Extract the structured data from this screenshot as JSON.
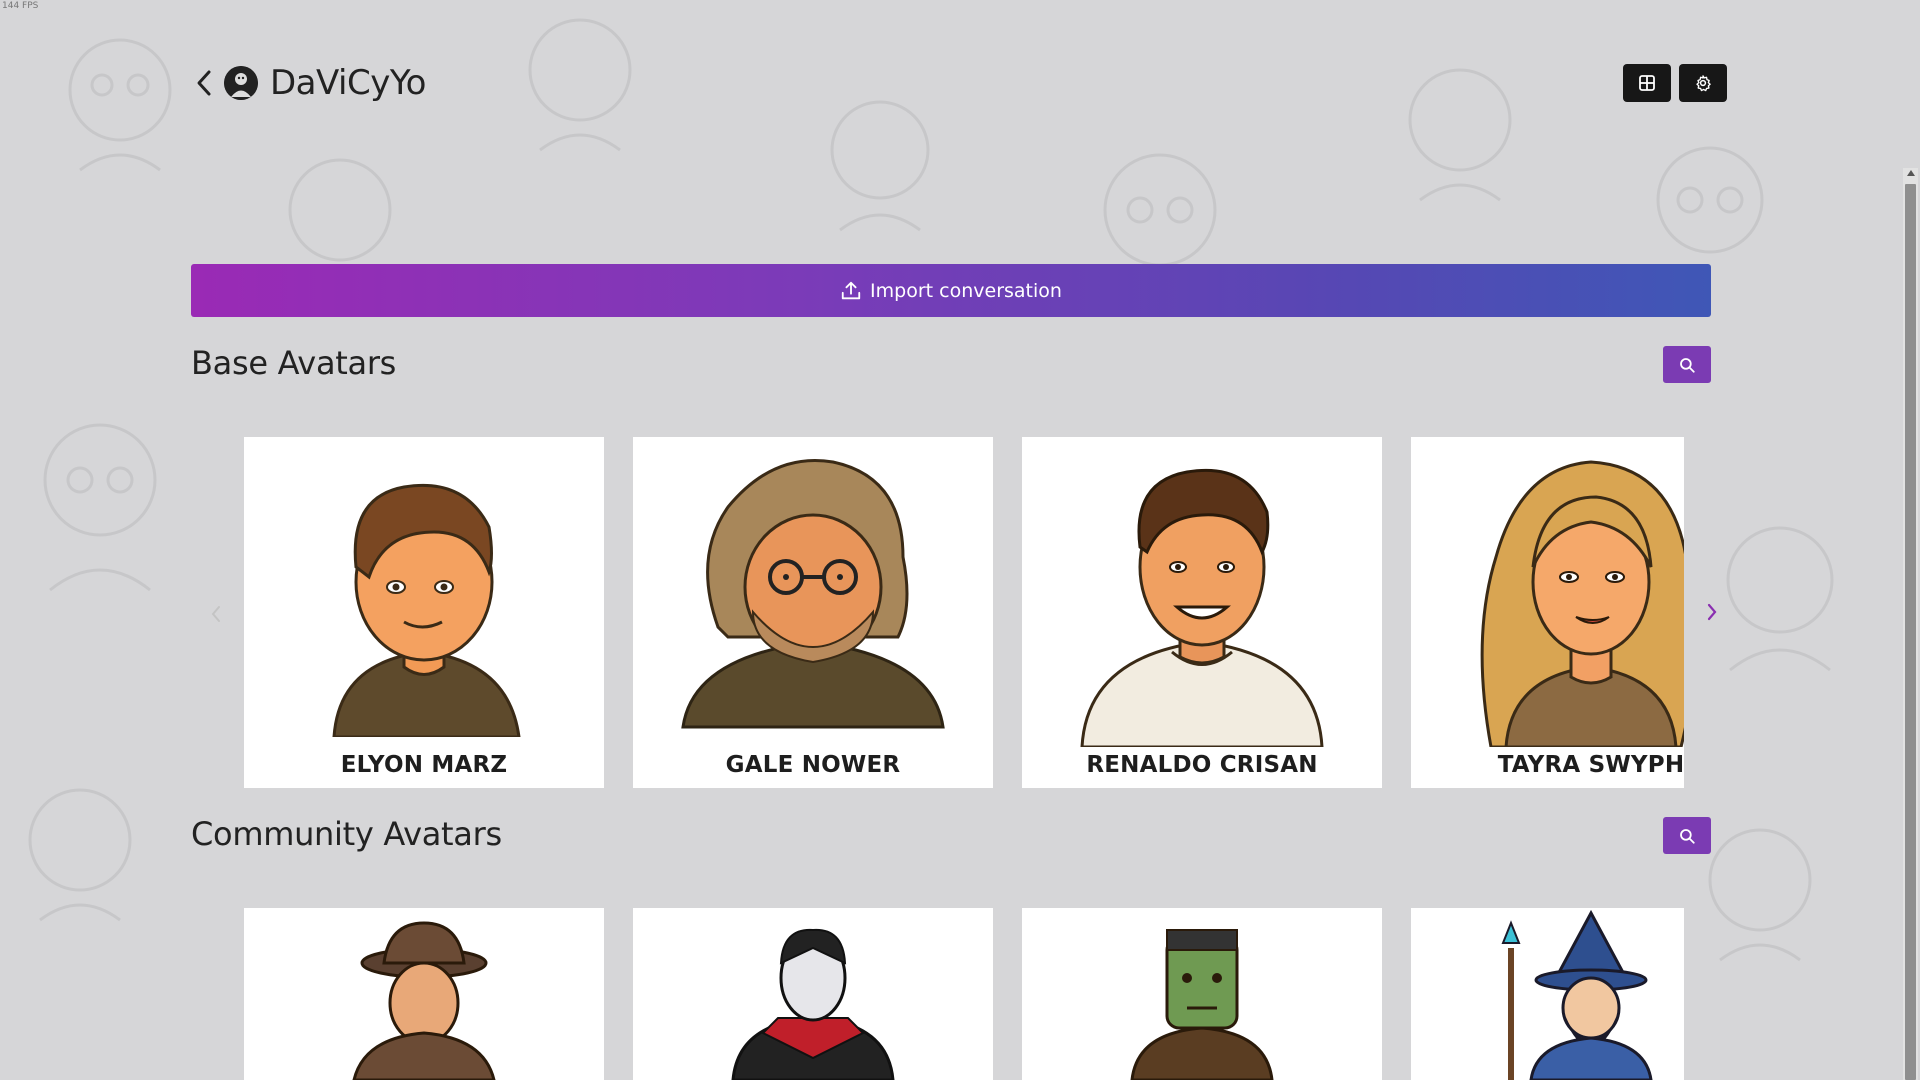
{
  "fps_label": "144 FPS",
  "header": {
    "title": "DaViCyYo"
  },
  "import": {
    "label": "Import conversation"
  },
  "sections": {
    "base": {
      "title": "Base Avatars",
      "cards": [
        {
          "name": "ELYON MARZ",
          "avatar": "man-short-brown-hair"
        },
        {
          "name": "GALE NOWER",
          "avatar": "man-long-hair-glasses-beard"
        },
        {
          "name": "RENALDO CRISAN",
          "avatar": "man-short-dark-hair-smile"
        },
        {
          "name": "TAYRA SWYPH",
          "avatar": "woman-blonde-hair"
        }
      ]
    },
    "community": {
      "title": "Community Avatars",
      "cards": [
        {
          "name": "",
          "avatar": "cowboy"
        },
        {
          "name": "",
          "avatar": "vampire"
        },
        {
          "name": "",
          "avatar": "frankenstein"
        },
        {
          "name": "",
          "avatar": "wizard"
        }
      ]
    }
  },
  "icons": {
    "back": "chevron-left-icon",
    "grid": "grid-icon",
    "settings": "gear-icon",
    "upload": "upload-icon",
    "search": "search-icon",
    "next": "chevron-right-icon",
    "prev": "chevron-left-icon"
  },
  "colors": {
    "background": "#d6d6d8",
    "gradient_start": "#9a2ab5",
    "gradient_end": "#3f57b6",
    "search_button": "#7b3bb3",
    "dark_button": "#171717",
    "next_arrow": "#8a2fb0"
  }
}
